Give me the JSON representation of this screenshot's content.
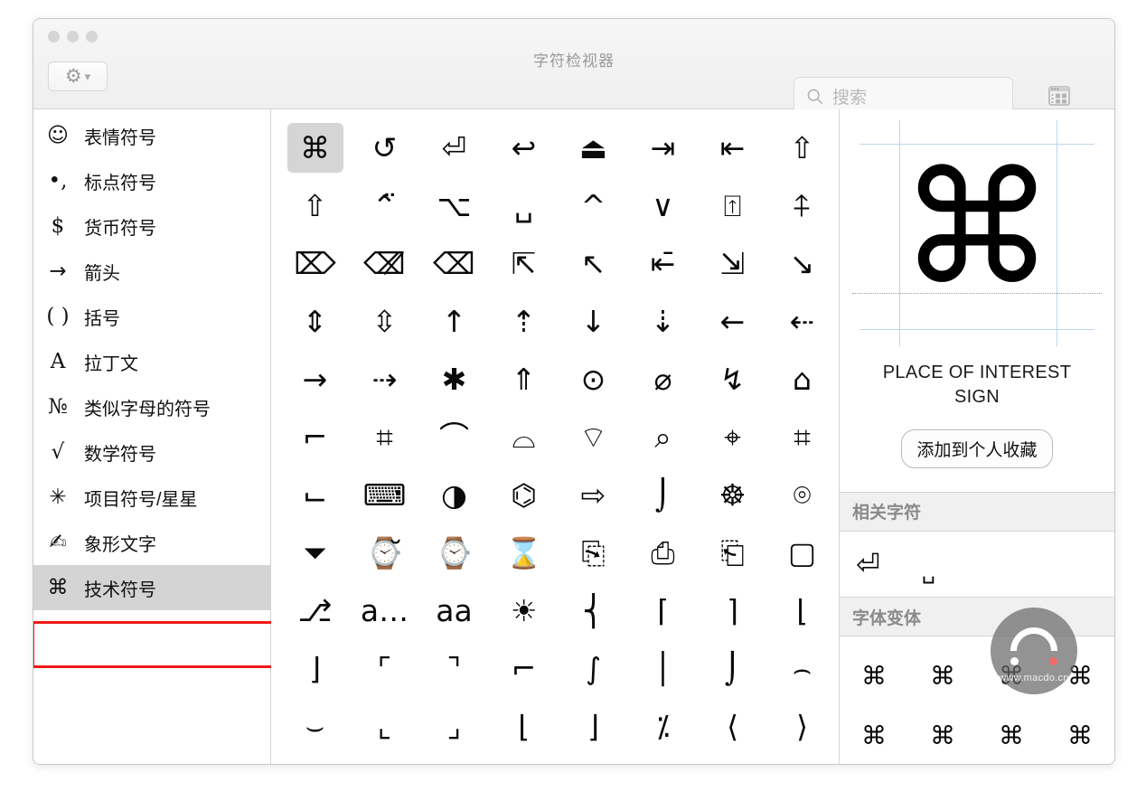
{
  "window": {
    "title": "字符检视器",
    "traffic_lights": [
      "close",
      "minimize",
      "zoom"
    ]
  },
  "toolbar": {
    "gear_label": "⚙",
    "chevron_label": "⌄",
    "panel_toggle_icon": "character-panel-icon",
    "search": {
      "placeholder": "搜索",
      "value": "",
      "icon": "search-icon"
    }
  },
  "sidebar": {
    "selected_index": 10,
    "selection_highlight_color": "#f01a1a",
    "items": [
      {
        "icon": "☺",
        "label": "表情符号",
        "serif": false
      },
      {
        "icon": "•,",
        "label": "标点符号",
        "serif": true
      },
      {
        "icon": "$",
        "label": "货币符号",
        "serif": true
      },
      {
        "icon": "→",
        "label": "箭头",
        "serif": false
      },
      {
        "icon": "( )",
        "label": "括号",
        "serif": true
      },
      {
        "icon": "A",
        "label": "拉丁文",
        "serif": true
      },
      {
        "icon": "№",
        "label": "类似字母的符号",
        "serif": true
      },
      {
        "icon": "√",
        "label": "数学符号",
        "serif": true
      },
      {
        "icon": "✳",
        "label": "项目符号/星星",
        "serif": false
      },
      {
        "icon": "✍",
        "label": "象形文字",
        "serif": false
      },
      {
        "icon": "⌘",
        "label": "技术符号",
        "serif": false
      }
    ]
  },
  "grid": {
    "columns": 8,
    "selected_index": 0,
    "characters": [
      "⌘",
      "↺",
      "⏎",
      "↩",
      "⏏",
      "⇥",
      "⇤",
      "⇧",
      "⇧",
      "⌃̈",
      "⌥",
      "␣",
      "^",
      "∨",
      "⍐",
      "⍏",
      "⌦",
      "⌫̸",
      "⌫",
      "⇱",
      "↖",
      "⇤̄",
      "⇲",
      "↘",
      "⇕",
      "⇳",
      "↑",
      "⇡",
      "↓",
      "⇣",
      "←",
      "⇠",
      "→",
      "⇢",
      "✱",
      "⇑",
      "⊙",
      "⌀",
      "↯",
      "⌂",
      "⌐",
      "⌗",
      "⌒",
      "⌓",
      "⌔",
      "⌕",
      "⌖",
      "⌗",
      "⌙",
      "⌨",
      "◑",
      "⌬",
      "⇨",
      "⌡",
      "☸",
      "⌾",
      "⏷",
      "⌚̆",
      "⌚",
      "⌛",
      "⎘",
      "⎙",
      "⎗",
      "▢",
      "⎇",
      "a…",
      "aa",
      "☀",
      "⎨",
      "⌈",
      "⌉",
      "⌊",
      "⌋",
      "⌜",
      "⌝",
      "⌐",
      "∫",
      "│",
      "⌡",
      "⌢",
      "⌣",
      "⌞",
      "⌟",
      "⌊",
      "⌋",
      "⁒",
      "⟨",
      "⟩"
    ]
  },
  "detail": {
    "preview_character": "⌘",
    "character_name": "PLACE OF INTEREST SIGN",
    "favorite_button": "添加到个人收藏",
    "related_section_title": "相关字符",
    "related_characters": [
      "⏎",
      "␣"
    ],
    "variants_section_title": "字体变体",
    "variants": [
      "⌘",
      "⌘",
      "⌘",
      "⌘",
      "⌘",
      "⌘",
      "⌘",
      "⌘"
    ]
  },
  "watermark": {
    "text": "www.macdo.cn"
  }
}
